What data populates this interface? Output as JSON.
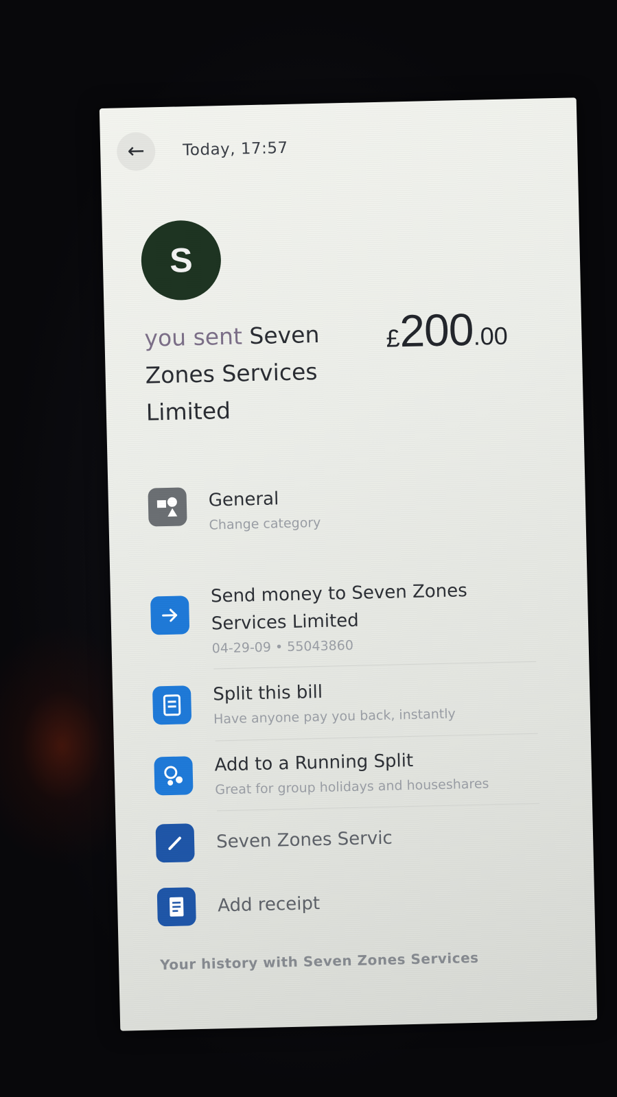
{
  "header": {
    "timestamp": "Today, 17:57"
  },
  "avatar": {
    "initial": "S",
    "color": "#1e3422"
  },
  "transaction": {
    "prefix": "you sent",
    "payee": "Seven Zones Services Limited",
    "currency": "£",
    "amount_whole": "200",
    "amount_decimal": ".00"
  },
  "actions": [
    {
      "title": "General",
      "subtitle": "Change category",
      "icon": "category-shapes-icon"
    },
    {
      "title": "Send money to Seven Zones Services Limited",
      "subtitle": "04-29-09 • 55043860",
      "icon": "arrow-right-icon"
    },
    {
      "title": "Split this bill",
      "subtitle": "Have anyone pay you back, instantly",
      "icon": "split-bill-icon"
    },
    {
      "title": "Add to a Running Split",
      "subtitle": "Great for group holidays and houseshares",
      "icon": "group-split-icon"
    },
    {
      "title": "Seven Zones Servic",
      "icon": "pencil-icon"
    },
    {
      "title": "Add receipt",
      "icon": "receipt-icon"
    }
  ],
  "history_title": "Your history with Seven Zones Services",
  "colors": {
    "accent_blue": "#1f7ad8",
    "category_grey": "#6b6f73"
  }
}
